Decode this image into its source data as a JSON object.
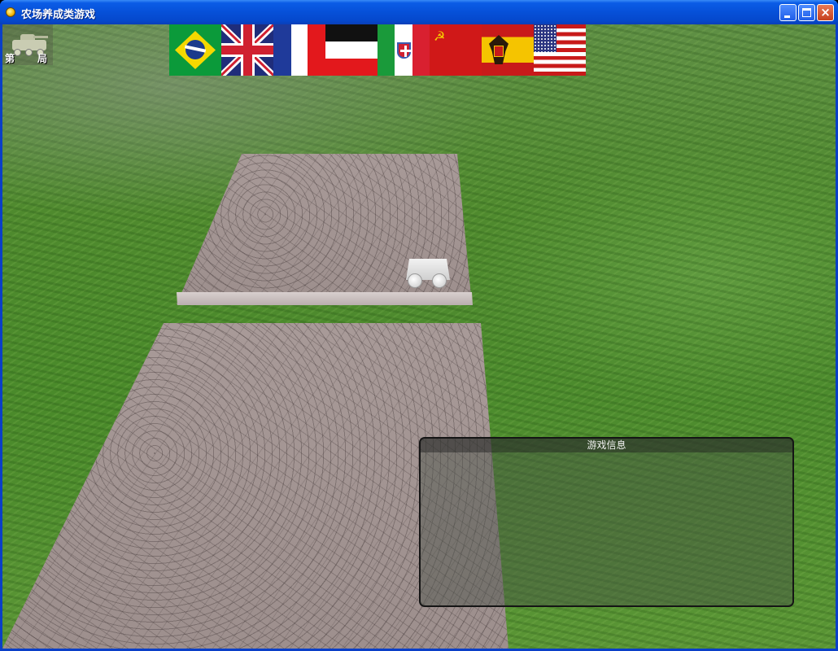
{
  "window": {
    "title": "农场养成类游戏",
    "controls": {
      "minimize": "minimize",
      "maximize": "maximize",
      "close": "×"
    }
  },
  "hud": {
    "level_prefix": "第",
    "level_suffix": "局",
    "emblem_icon": "tank-icon"
  },
  "flags": [
    {
      "name": "brazil",
      "icon": "brazil-flag-icon"
    },
    {
      "name": "united-kingdom",
      "icon": "uk-flag-icon"
    },
    {
      "name": "france",
      "icon": "france-flag-icon"
    },
    {
      "name": "german-empire",
      "icon": "german-empire-flag-icon"
    },
    {
      "name": "italy",
      "icon": "italy-flag-icon"
    },
    {
      "name": "soviet-union",
      "icon": "ussr-flag-icon",
      "symbol": "☭"
    },
    {
      "name": "spain",
      "icon": "spain-flag-icon"
    },
    {
      "name": "united-states",
      "icon": "usa-flag-icon"
    }
  ],
  "scene": {
    "cart_icon": "cart-icon"
  },
  "info_panel": {
    "title": "游戏信息",
    "content": ""
  },
  "colors": {
    "titlebar": "#0650d8",
    "grass": "#4f8a2e",
    "stone": "#a89a98",
    "panel_border": "#151515"
  }
}
